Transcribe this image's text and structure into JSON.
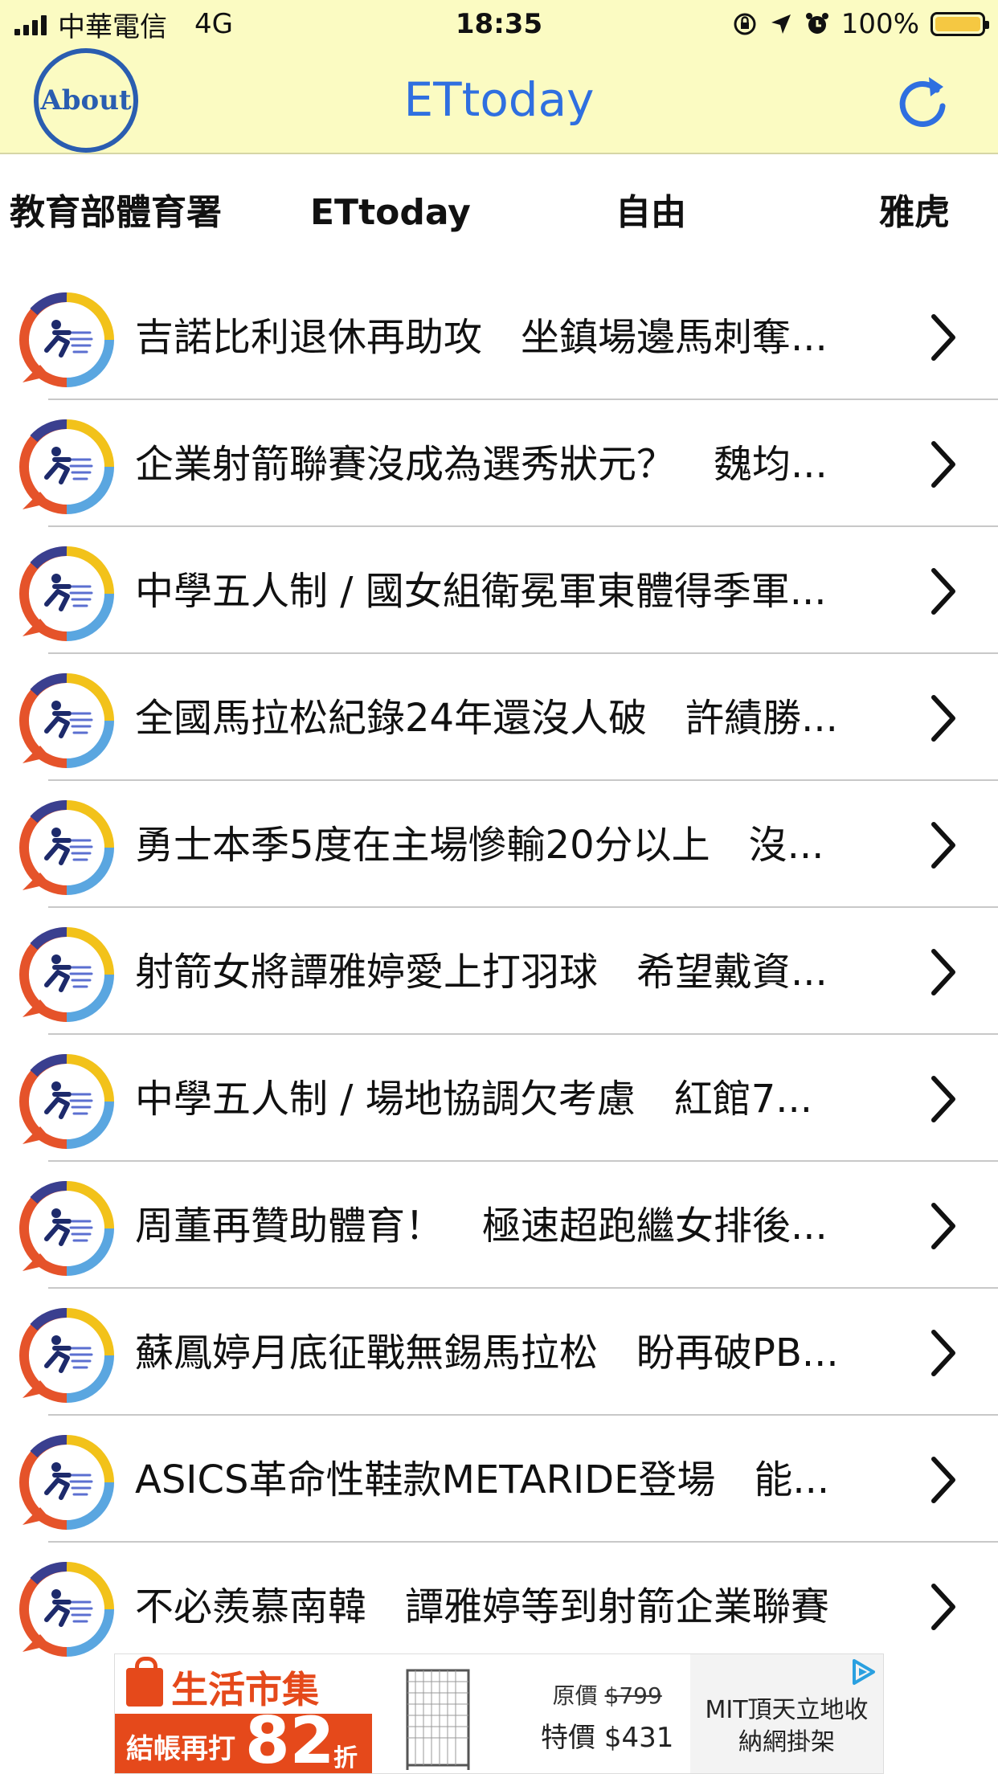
{
  "status_bar": {
    "carrier": "中華電信",
    "network": "4G",
    "time": "18:35",
    "battery": "100%"
  },
  "nav": {
    "about_label": "About",
    "title": "ETtoday"
  },
  "tabs": [
    {
      "label": "教育部體育署"
    },
    {
      "label": "ETtoday"
    },
    {
      "label": "自由"
    },
    {
      "label": "雅虎"
    }
  ],
  "articles": [
    {
      "title": "吉諾比利退休再助攻　坐鎮場邊馬刺奪..."
    },
    {
      "title": "企業射箭聯賽沒成為選秀狀元？　魏均..."
    },
    {
      "title": "中學五人制 / 國女組衛冕軍東體得季軍..."
    },
    {
      "title": "全國馬拉松紀錄24年還沒人破　許績勝..."
    },
    {
      "title": "勇士本季5度在主場慘輸20分以上　沒..."
    },
    {
      "title": "射箭女將譚雅婷愛上打羽球　希望戴資..."
    },
    {
      "title": "中學五人制 / 場地協調欠考慮　紅館7..."
    },
    {
      "title": "周董再贊助體育！　極速超跑繼女排後..."
    },
    {
      "title": "蘇鳳婷月底征戰無錫馬拉松　盼再破PB..."
    },
    {
      "title": "ASICS革命性鞋款METARIDE登場　能..."
    },
    {
      "title": "不必羨慕南韓　譚雅婷等到射箭企業聯賽"
    }
  ],
  "ad": {
    "brand": "生活市集",
    "promo_prefix": "結帳再打",
    "promo_number": "82",
    "promo_suffix": "折",
    "orig_label": "原價",
    "orig_price": "$799",
    "sale_label": "特價",
    "sale_price": "$431",
    "desc_line1": "MIT頂天立地收",
    "desc_line2": "納網掛架"
  },
  "colors": {
    "header_bg": "#fbfbc2",
    "accent_blue": "#2f6fe0",
    "about_blue": "#2a5db0",
    "ad_orange": "#e5491b"
  }
}
